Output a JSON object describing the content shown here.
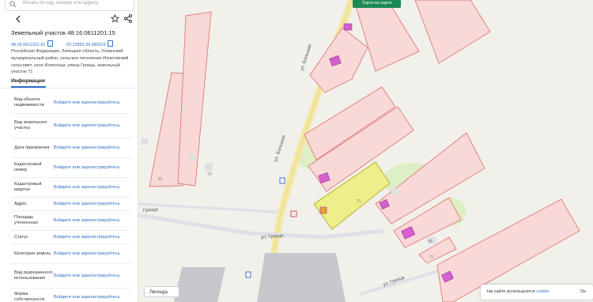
{
  "search": {
    "placeholder": "Искать по кад. номеру или адресу"
  },
  "card": {
    "title": "Земельный участок 48:16:0611201:15",
    "cad_number": "48:16:0611201:15",
    "old_number": "52:13892:39.380023",
    "address": "Российская Федерация, Липецкая область, Усманский муниципальный район, сельское поселение Излеговский сельсовет, село Излегощи, улица Грязца, земельный участок 71",
    "tab": "Информация",
    "rows": [
      {
        "key": "Вид объекта недвижимости",
        "value": "Войдите или зарегистрируйтесь"
      },
      {
        "key": "Вид земельного участка",
        "value": "Войдите или зарегистрируйтесь"
      },
      {
        "key": "Дата присвоения",
        "value": "Войдите или зарегистрируйтесь"
      },
      {
        "key": "Кадастровый номер",
        "value": "Войдите или зарегистрируйтесь"
      },
      {
        "key": "Кадастровый квартал",
        "value": "Войдите или зарегистрируйтесь"
      },
      {
        "key": "Адрес",
        "value": "Войдите или зарегистрируйтесь"
      },
      {
        "key": "Площадь уточненная",
        "value": "Войдите или зарегистрируйтесь"
      },
      {
        "key": "Статус",
        "value": "Войдите или зарегистрируйтесь"
      },
      {
        "key": "Категория земель",
        "value": "Войдите или зарегистрируйтесь"
      },
      {
        "key": "Вид разрешенного использования",
        "value": "Войдите или зарегистрируйтесь"
      },
      {
        "key": "Форма собственности",
        "value": "Войдите или зарегистрируйтесь"
      }
    ]
  },
  "map": {
    "trade_button": "Торги на карте",
    "legend": "Легенда",
    "cookie_text": "На сайте используются",
    "cookie_link": "cookie",
    "cookie_more": "Ок",
    "street_labels": {
      "bolshaya": "ул. Большая",
      "gryazca": "ул. Грязца",
      "gryazca2": "Грязца",
      "other": "ул. Грязца"
    },
    "parcel_numbers": [
      "61",
      "71",
      "55",
      "77",
      "73"
    ]
  },
  "colors": {
    "accent": "#2f6ec7",
    "parcel_fill": "#f8d9d7",
    "parcel_stroke": "#e07a78",
    "selected_fill": "#eeee8a",
    "building": "#d45fce",
    "road": "#f4e8a6",
    "trade": "#1d8a55"
  }
}
